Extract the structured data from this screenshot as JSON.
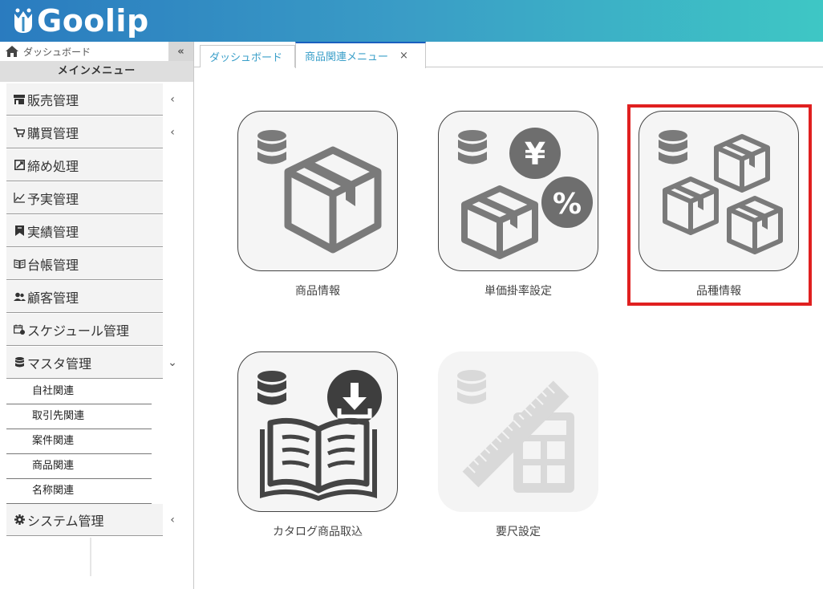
{
  "app": {
    "logo_text": "Goolip"
  },
  "sidebar": {
    "dashboard_label": "ダッシュボード",
    "collapse_label": "«",
    "main_menu_title": "メインメニュー",
    "items": [
      {
        "label": "販売管理",
        "icon": "shop-icon",
        "chevron": "‹"
      },
      {
        "label": "購買管理",
        "icon": "cart-icon",
        "chevron": "‹"
      },
      {
        "label": "締め処理",
        "icon": "closing-icon",
        "chevron": ""
      },
      {
        "label": "予実管理",
        "icon": "chart-line-icon",
        "chevron": ""
      },
      {
        "label": "実績管理",
        "icon": "bookmark-icon",
        "chevron": ""
      },
      {
        "label": "台帳管理",
        "icon": "book-icon",
        "chevron": ""
      },
      {
        "label": "顧客管理",
        "icon": "users-icon",
        "chevron": ""
      },
      {
        "label": "スケジュール管理",
        "icon": "calendar-icon",
        "chevron": ""
      },
      {
        "label": "マスタ管理",
        "icon": "database-icon",
        "chevron": "⌄"
      },
      {
        "label": "システム管理",
        "icon": "gear-icon",
        "chevron": "‹"
      }
    ],
    "master_submenu": [
      "自社関連",
      "取引先関連",
      "案件関連",
      "商品関連",
      "名称関連"
    ]
  },
  "tabs": [
    {
      "label": "ダッシュボード"
    },
    {
      "label": "商品関連メニュー",
      "close": "×"
    }
  ],
  "tiles": [
    {
      "label": "商品情報",
      "icon": "product-box-icon",
      "enabled": true
    },
    {
      "label": "単価掛率設定",
      "icon": "price-rate-icon",
      "enabled": true
    },
    {
      "label": "品種情報",
      "icon": "product-types-icon",
      "enabled": true,
      "highlighted": true
    },
    {
      "label": "カタログ商品取込",
      "icon": "catalog-import-icon",
      "enabled": true
    },
    {
      "label": "要尺設定",
      "icon": "measure-calculator-icon",
      "enabled": false
    }
  ],
  "colors": {
    "highlight": "#e02020",
    "tab_active": "#1b5fbf",
    "tab_text": "#3a9fc9",
    "icon_gray": "#7a7a7a",
    "icon_dark": "#444444"
  }
}
